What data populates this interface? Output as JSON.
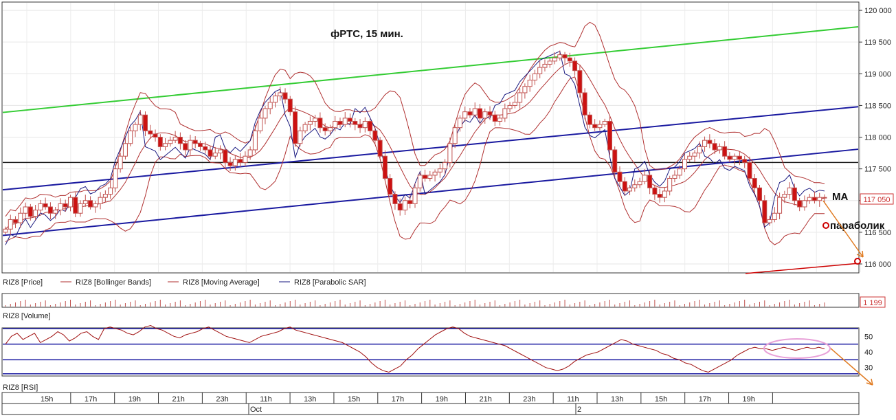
{
  "chart_data": {
    "type": "candlestick",
    "title": "фРТС, 15 мин.",
    "price_axis": {
      "ylim": [
        115870,
        120120
      ],
      "ticks": [
        120000,
        119500,
        119000,
        118500,
        118000,
        117500,
        117000,
        116500,
        116000
      ],
      "tick_labels": [
        "120 000",
        "119 500",
        "119 000",
        "118 500",
        "118 000",
        "117 500",
        "117 000",
        "116 500",
        "116 000"
      ],
      "last_price_label": "117 050",
      "last_price": 117050
    },
    "legend": [
      {
        "label": "RIZ8 [Price]",
        "color": "#c0504d"
      },
      {
        "label": "RIZ8 [Bollinger Bands]",
        "color": "#b03030"
      },
      {
        "label": "RIZ8 [Moving Average]",
        "color": "#b03030"
      },
      {
        "label": "RIZ8 [Parabolic SAR]",
        "color": "#1a1a80"
      }
    ],
    "annotations": {
      "ma": "MA",
      "parabolic": "параболик"
    },
    "horizontal_level": 117600,
    "trend_lines": [
      {
        "name": "green_channel",
        "color": "#33cc33",
        "y_start": 118390,
        "y_end": 119740
      },
      {
        "name": "blue_upper",
        "color": "#1a1aa0",
        "y_start": 117170,
        "y_end": 118480
      },
      {
        "name": "blue_mid",
        "color": "#1a1aa0",
        "y_start": null,
        "y_end": 117800
      },
      {
        "name": "blue_lower",
        "color": "#1a1aa0",
        "y_start": 116450,
        "y_end": 117810
      },
      {
        "name": "red_target",
        "color": "#cc0000",
        "y_start": 115850,
        "y_end": 116010
      }
    ],
    "candles_close": [
      116550,
      116700,
      116650,
      116800,
      116900,
      116750,
      116850,
      116950,
      116900,
      116800,
      116850,
      116950,
      116900,
      117050,
      116800,
      116950,
      117000,
      116900,
      116950,
      117050,
      117100,
      117200,
      117500,
      117700,
      117900,
      118100,
      118200,
      118350,
      118100,
      118050,
      118000,
      117850,
      117900,
      117950,
      118000,
      117900,
      117800,
      117950,
      117900,
      117850,
      117800,
      117700,
      117750,
      117800,
      117600,
      117550,
      117650,
      117600,
      117700,
      117800,
      118100,
      118300,
      118450,
      118550,
      118650,
      118700,
      118600,
      118400,
      117900,
      118100,
      118200,
      118250,
      118300,
      118150,
      118100,
      118150,
      118250,
      118200,
      118300,
      118250,
      118200,
      118150,
      118250,
      118100,
      117950,
      117700,
      117350,
      117100,
      116950,
      116850,
      117000,
      116950,
      117200,
      117400,
      117350,
      117400,
      117450,
      117500,
      117600,
      117900,
      118150,
      118300,
      118400,
      118350,
      118450,
      118300,
      118400,
      118350,
      118250,
      118300,
      118450,
      118500,
      118550,
      118700,
      118800,
      118900,
      119000,
      119100,
      119150,
      119200,
      119250,
      119300,
      119250,
      119200,
      119050,
      118700,
      118350,
      118200,
      118150,
      118200,
      118250,
      117800,
      117450,
      117300,
      117150,
      117200,
      117250,
      117300,
      117400,
      117200,
      117100,
      117050,
      117150,
      117350,
      117400,
      117500,
      117650,
      117700,
      117750,
      117850,
      117950,
      117900,
      117800,
      117850,
      117700,
      117650,
      117700,
      117650,
      117600,
      117350,
      117200,
      117000,
      116650,
      116700,
      116800,
      117050,
      117100,
      117200,
      117000,
      116900,
      117000,
      117050,
      117000,
      117050,
      117050
    ],
    "volume_label": "1 199",
    "rsi_axis": {
      "ticks": [
        50,
        40,
        30
      ],
      "tick_labels": [
        "50",
        "40",
        "30"
      ],
      "levels": [
        55,
        45,
        35,
        26
      ],
      "ylim": [
        25,
        55
      ]
    },
    "rsi_values": [
      45,
      50,
      52,
      48,
      50,
      52,
      46,
      48,
      50,
      53,
      51,
      47,
      49,
      52,
      53,
      50,
      48,
      55,
      56,
      55,
      54,
      52,
      51,
      53,
      56,
      57,
      55,
      54,
      52,
      50,
      49,
      51,
      52,
      53,
      55,
      56,
      54,
      52,
      50,
      49,
      48,
      47,
      46,
      48,
      50,
      51,
      52,
      53,
      55,
      56,
      54,
      53,
      52,
      51,
      50,
      49,
      48,
      47,
      46,
      44,
      42,
      40,
      37,
      33,
      30,
      28,
      27,
      29,
      31,
      35,
      38,
      42,
      45,
      48,
      51,
      53,
      55,
      56,
      55,
      52,
      50,
      49,
      48,
      47,
      46,
      45,
      44,
      42,
      40,
      38,
      36,
      34,
      32,
      30,
      29,
      28,
      29,
      31,
      34,
      36,
      38,
      39,
      40,
      42,
      44,
      46,
      48,
      47,
      45,
      44,
      43,
      42,
      41,
      39,
      38,
      36,
      35,
      33,
      32,
      30,
      28,
      27,
      29,
      31,
      33,
      35,
      38,
      40,
      42,
      43,
      42,
      42,
      41,
      42,
      43,
      42,
      41,
      42,
      43,
      42,
      43,
      42
    ],
    "time_axis": {
      "labels": [
        "15h",
        "17h",
        "19h",
        "21h",
        "23h",
        "11h",
        "13h",
        "15h",
        "17h",
        "19h",
        "21h",
        "23h",
        "11h",
        "13h",
        "15h",
        "17h",
        "19h"
      ],
      "dates": [
        "Oct",
        "2"
      ]
    },
    "panels": {
      "price": "RIZ8 [Price]",
      "volume": "RIZ8 [Volume]",
      "rsi": "RIZ8 [RSI]"
    }
  }
}
